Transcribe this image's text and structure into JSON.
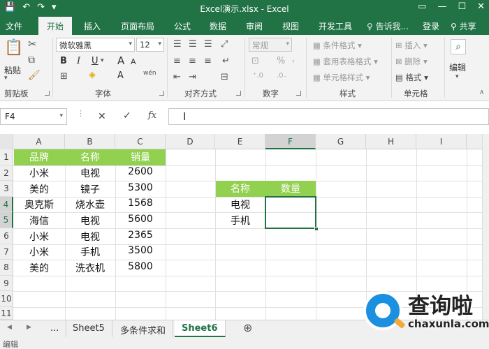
{
  "window": {
    "title": "Excel演示.xlsx - Excel",
    "controls": [
      "▭",
      "—",
      "☐",
      "✕"
    ]
  },
  "qat": {
    "save": "💾",
    "undo": "↶",
    "redo": "↷",
    "more": "▾"
  },
  "ribbon_tabs": [
    "文件",
    "开始",
    "插入",
    "页面布局",
    "公式",
    "数据",
    "审阅",
    "视图",
    "开发工具"
  ],
  "active_tab": "开始",
  "tell_me": "♀ 告诉我...",
  "login": "登录",
  "share": "共享",
  "ribbon": {
    "clipboard": {
      "label": "剪贴板",
      "paste": "粘贴"
    },
    "font": {
      "label": "字体",
      "name": "微软雅黑",
      "size": "12",
      "bold": "B",
      "italic": "I",
      "underline": "U",
      "grow": "A",
      "shrink": "A",
      "wen": "wén"
    },
    "alignment": {
      "label": "对齐方式"
    },
    "number": {
      "label": "数字",
      "format": "常规",
      "percent": "%",
      "comma": ","
    },
    "styles": {
      "label": "样式",
      "conditional": "条件格式 ▾",
      "table": "套用表格格式 ▾",
      "cell": "单元格样式 ▾"
    },
    "cells": {
      "label": "单元格",
      "insert": "插入 ▾",
      "delete": "删除 ▾",
      "format": "格式 ▾"
    },
    "editing": {
      "label": "编辑"
    }
  },
  "formula_bar": {
    "name_box": "F4",
    "value": ""
  },
  "columns": [
    "A",
    "B",
    "C",
    "D",
    "E",
    "F",
    "G",
    "H",
    "I"
  ],
  "selected_column": "F",
  "rows": [
    "1",
    "2",
    "3",
    "4",
    "5",
    "6",
    "7",
    "8",
    "9",
    "10",
    "11"
  ],
  "selected_rows": [
    "4",
    "5"
  ],
  "table1": {
    "headers": [
      "品牌",
      "名称",
      "销量"
    ],
    "rows": [
      [
        "小米",
        "电视",
        "2600"
      ],
      [
        "美的",
        "镜子",
        "5300"
      ],
      [
        "奥克斯",
        "烧水壶",
        "1568"
      ],
      [
        "海信",
        "电视",
        "5600"
      ],
      [
        "小米",
        "电视",
        "2365"
      ],
      [
        "小米",
        "手机",
        "3500"
      ],
      [
        "美的",
        "洗衣机",
        "5800"
      ]
    ]
  },
  "table2": {
    "headers": [
      "名称",
      "数量"
    ],
    "rows": [
      [
        "电视",
        ""
      ],
      [
        "手机",
        ""
      ]
    ]
  },
  "sheets": {
    "nav_prev": "◀",
    "nav_next": "▶",
    "ellipsis": "...",
    "tabs": [
      "Sheet5",
      "多条件求和",
      "Sheet6"
    ],
    "active": "Sheet6",
    "add": "⊕"
  },
  "status": {
    "mode": "编辑"
  },
  "watermark": {
    "brand": "查询啦",
    "site": "chaxunla.com"
  },
  "colors": {
    "excel_green": "#217346",
    "header_fill": "#92d050"
  }
}
